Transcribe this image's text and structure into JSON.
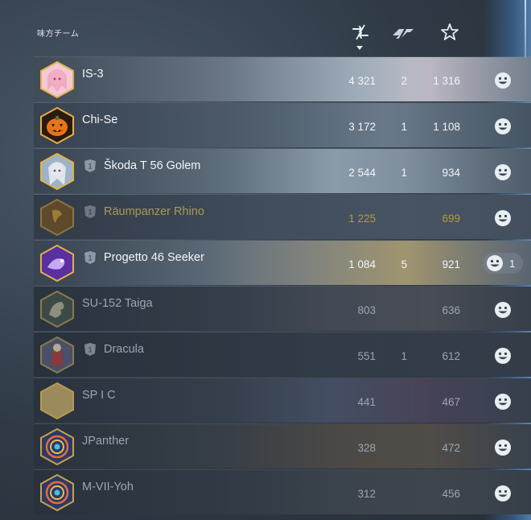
{
  "header": {
    "team_label": "味方チーム",
    "columns": [
      {
        "icon": "damage-sort-icon",
        "sorted": true
      },
      {
        "icon": "kills-icon"
      },
      {
        "icon": "star-xp-icon"
      }
    ]
  },
  "players": [
    {
      "name": "IS-3",
      "tier_badge": "",
      "damage": "4 321",
      "kills": "2",
      "xp": "1 316",
      "reactions": "",
      "state": "alive",
      "avatar": "anime-girl-pink-avatar"
    },
    {
      "name": "Chi-Se",
      "tier_badge": "",
      "damage": "3 172",
      "kills": "1",
      "xp": "1 108",
      "reactions": "",
      "state": "alive",
      "avatar": "pumpkin-avatar"
    },
    {
      "name": "Škoda T 56 Golem",
      "tier_badge": "1",
      "damage": "2 544",
      "kills": "1",
      "xp": "934",
      "reactions": "",
      "state": "alive",
      "avatar": "anime-girl-white-avatar"
    },
    {
      "name": "Räumpanzer Rhino",
      "tier_badge": "1",
      "damage": "1 225",
      "kills": "",
      "xp": "699",
      "reactions": "",
      "state": "destroyed",
      "avatar": "gold-emblem-avatar"
    },
    {
      "name": "Progetto 46 Seeker",
      "tier_badge": "1",
      "damage": "1 084",
      "kills": "5",
      "xp": "921",
      "reactions": "1",
      "state": "alive",
      "avatar": "purple-creature-avatar"
    },
    {
      "name": "SU-152 Taiga",
      "tier_badge": "",
      "damage": "803",
      "kills": "",
      "xp": "636",
      "reactions": "",
      "state": "dim",
      "avatar": "dragon-emblem-avatar"
    },
    {
      "name": "Dracula",
      "tier_badge": "1",
      "damage": "551",
      "kills": "1",
      "xp": "612",
      "reactions": "",
      "state": "dim",
      "avatar": "knight-avatar"
    },
    {
      "name": "SP I C",
      "tier_badge": "",
      "damage": "441",
      "kills": "",
      "xp": "467",
      "reactions": "",
      "state": "dim",
      "avatar": "plain-gold-avatar"
    },
    {
      "name": "JPanther",
      "tier_badge": "",
      "damage": "328",
      "kills": "",
      "xp": "472",
      "reactions": "",
      "state": "dim",
      "avatar": "mandala-avatar"
    },
    {
      "name": "M-VII-Yoh",
      "tier_badge": "",
      "damage": "312",
      "kills": "",
      "xp": "456",
      "reactions": "",
      "state": "dim",
      "avatar": "mandala-avatar"
    }
  ],
  "colors": {
    "accent_gold": "#d8b24a",
    "destroyed_text": "#b99a3a",
    "text": "#f2f5f8",
    "dim_text": "#9aa6b2"
  }
}
